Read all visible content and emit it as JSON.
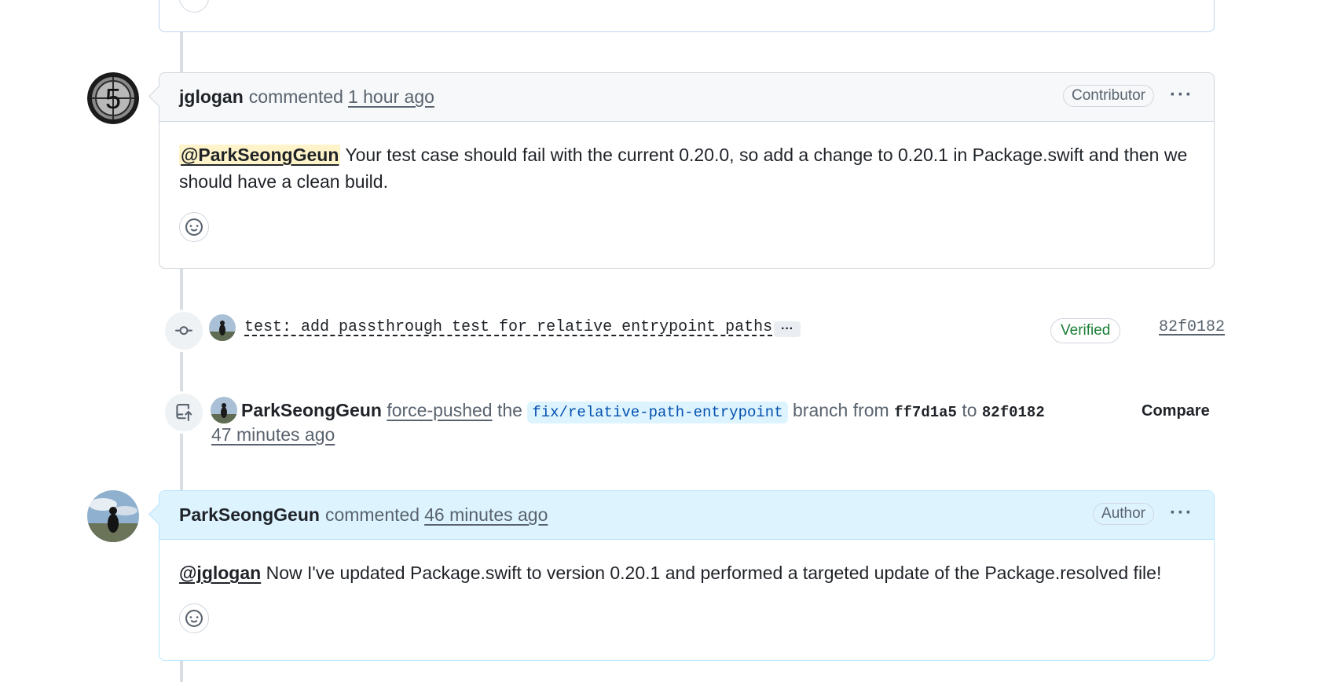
{
  "comment1": {
    "author": "jglogan",
    "action": "commented",
    "time": "1 hour ago",
    "badge": "Contributor",
    "mention": "@ParkSeongGeun",
    "body": " Your test case should fail with the current 0.20.0, so add a change to 0.20.1 in Package.swift and then we should have a clean build.",
    "avatar_digit": "5"
  },
  "commit": {
    "message": "test: add passthrough test for relative entrypoint paths",
    "expand_label": "···",
    "verified_label": "Verified",
    "sha": "82f0182"
  },
  "force_push": {
    "user": "ParkSeongGeun",
    "action": "force-pushed",
    "word_the": "the",
    "branch": "fix/relative-path-entrypoint",
    "word_branch_from": "branch from",
    "from_sha": "ff7d1a5",
    "word_to": "to",
    "to_sha": "82f0182",
    "time": "47 minutes ago",
    "compare_label": "Compare"
  },
  "comment2": {
    "author": "ParkSeongGeun",
    "action": "commented",
    "time": "46 minutes ago",
    "badge": "Author",
    "mention": "@jglogan",
    "body": " Now I've updated Package.swift to version 0.20.1 and performed a targeted update of the Package.resolved file!"
  },
  "kebab_label": "···",
  "colors": {
    "accent_blue": "#0969da",
    "verified_green": "#1a7f37",
    "author_header_bg": "#ddf4ff",
    "mention_highlight": "#fff3c9"
  },
  "icons": [
    "smiley-icon",
    "git-commit-icon",
    "repo-push-icon",
    "kebab-horizontal-icon"
  ]
}
